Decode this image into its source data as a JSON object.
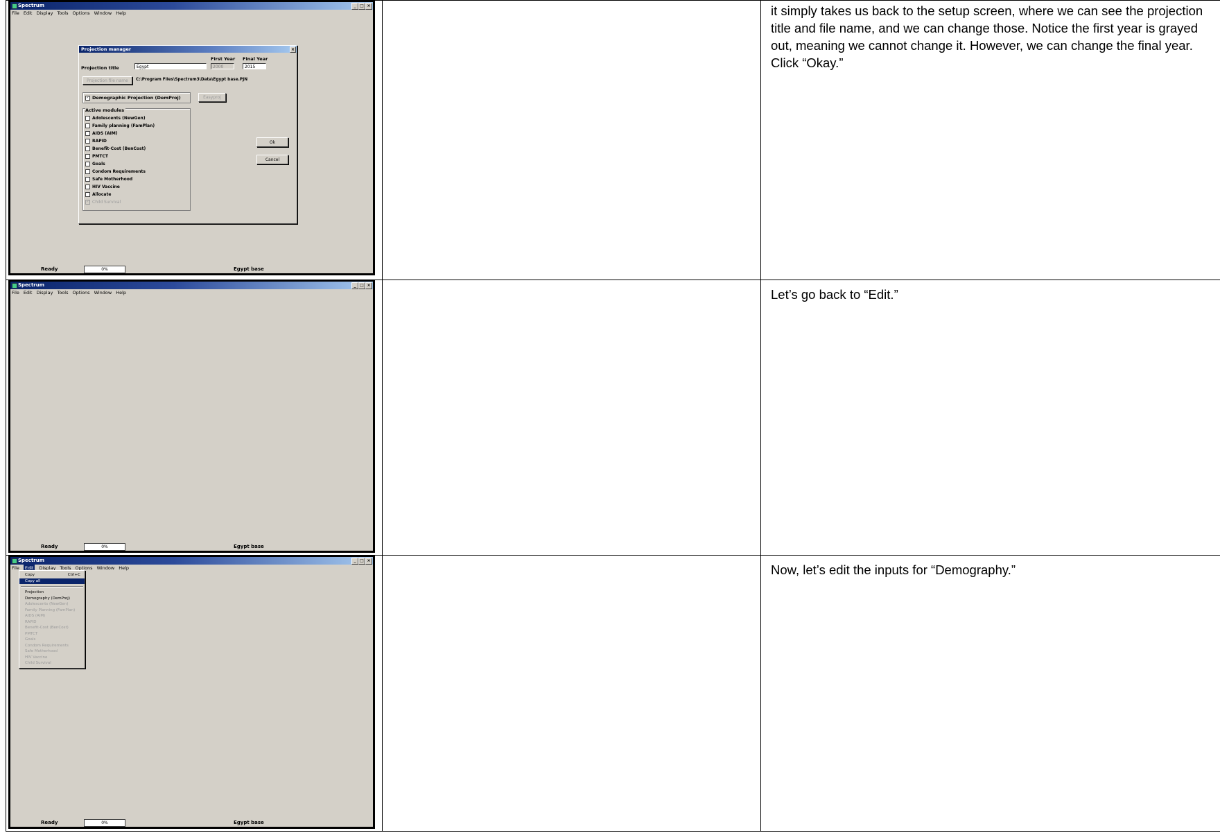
{
  "window": {
    "title": "Spectrum",
    "menu": [
      "File",
      "Edit",
      "Display",
      "Tools",
      "Options",
      "Window",
      "Help"
    ],
    "buttons": [
      "_",
      "□",
      "×"
    ]
  },
  "status": {
    "ready": "Ready",
    "progress": "0%",
    "projection": "Egypt base"
  },
  "dialog": {
    "title": "Projection manager",
    "close": "×",
    "first_year_label": "First Year",
    "final_year_label": "Final Year",
    "projection_title_label": "Projection title",
    "projection_title_value": "Egypt",
    "first_year_value": "2000",
    "final_year_value": "2015",
    "file_name_button": "Projection file name",
    "file_path": "C:\\Program Files\\Spectrum3\\Data\\Egypt base.PJN",
    "dem_proj_label": "Demographic Projection (DemProj)",
    "easyproj_button": "Easyproj",
    "active_modules_label": "Active modules",
    "modules": [
      "Adolescents (NewGen)",
      "Family planning (FamPlan)",
      "AIDS (AIM)",
      "RAPID",
      "Benefit-Cost (BenCost)",
      "PMTCT",
      "Goals",
      "Condom Requirements",
      "Safe Motherhood",
      "HIV Vaccine",
      "Allocate",
      "Child Survival"
    ],
    "ok_button": "Ok",
    "cancel_button": "Cancel"
  },
  "edit_menu": {
    "copy": "Copy",
    "copy_shortcut": "Ctrl+C",
    "copy_all": "Copy all",
    "projection": "Projection",
    "demography": "Demography (DemProj)",
    "disabled_items": [
      "Adolescents (NewGen)",
      "Family Planning (FamPlan)",
      "AIDS (AIM)",
      "RAPID",
      "Benefit-Cost (BenCost)",
      "PMTCT",
      "Goals",
      "Condom Requirements",
      "Safe Motherhood",
      "HIV Vaccine",
      "Child Survival"
    ]
  },
  "narration": {
    "row1": "it simply takes us back to the setup screen, where we can see the projection title and file name, and we can change those. Notice the first year is grayed out, meaning we cannot change it. However, we can change the final year. Click “Okay.”",
    "row2": "Let’s go back to “Edit.”",
    "row3": "Now, let’s edit the inputs for “Demography.”"
  }
}
